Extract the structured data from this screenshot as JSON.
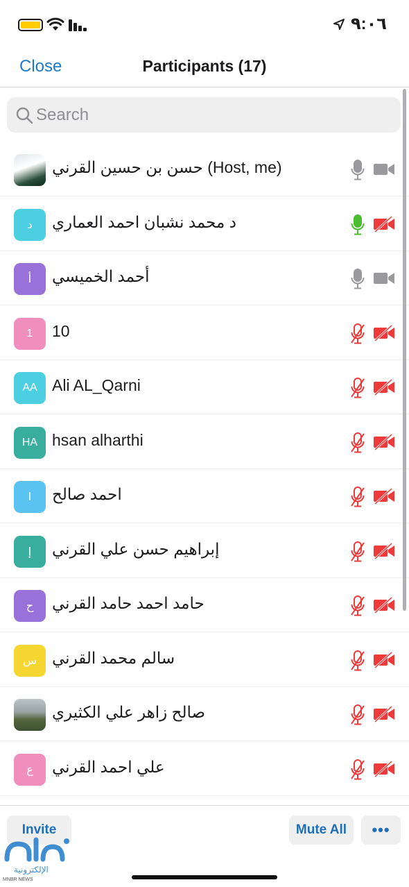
{
  "status_bar": {
    "time": "٩:٠٦",
    "icons": [
      "battery-icon",
      "wifi-icon",
      "signal-icon",
      "location-arrow-icon"
    ],
    "battery_color": "#ffcc00"
  },
  "nav": {
    "close_label": "Close",
    "title": "Participants (17)"
  },
  "search": {
    "placeholder": "Search",
    "value": ""
  },
  "participants": [
    {
      "name": "حسن بن حسين القرني (Host, me)",
      "avatar": "photo",
      "initials": "",
      "color": "",
      "mic": "on-idle",
      "camera": "on"
    },
    {
      "name": "د محمد نشبان احمد العماري",
      "avatar": "initials",
      "initials": "د",
      "color": "#4ccfe0",
      "mic": "speaking",
      "camera": "off"
    },
    {
      "name": "أحمد الخميسي",
      "avatar": "initials",
      "initials": "أ",
      "color": "#9872d8",
      "mic": "on-idle",
      "camera": "on"
    },
    {
      "name": "10",
      "avatar": "initials",
      "initials": "1",
      "color": "#f08fbd",
      "mic": "muted",
      "camera": "off"
    },
    {
      "name": "Ali AL_Qarni",
      "avatar": "initials",
      "initials": "AA",
      "color": "#4ccfe0",
      "mic": "muted",
      "camera": "off"
    },
    {
      "name": "hsan alharthi",
      "avatar": "initials",
      "initials": "HA",
      "color": "#3aae9e",
      "mic": "muted",
      "camera": "off"
    },
    {
      "name": "احمد صالح",
      "avatar": "initials",
      "initials": "ا",
      "color": "#5ac3f2",
      "mic": "muted",
      "camera": "off"
    },
    {
      "name": "إبراهيم حسن علي القرني",
      "avatar": "initials",
      "initials": "إ",
      "color": "#3aae9e",
      "mic": "muted",
      "camera": "off"
    },
    {
      "name": "حامد احمد حامد القرني",
      "avatar": "initials",
      "initials": "ح",
      "color": "#9872d8",
      "mic": "muted",
      "camera": "off"
    },
    {
      "name": "سالم محمد القرني",
      "avatar": "initials",
      "initials": "س",
      "color": "#f6d630",
      "mic": "muted",
      "camera": "off"
    },
    {
      "name": "صالح زاهر علي الكثيري",
      "avatar": "photo",
      "initials": "",
      "color": "",
      "mic": "muted",
      "camera": "off"
    },
    {
      "name": "علي احمد القرني",
      "avatar": "initials",
      "initials": "ع",
      "color": "#f08fbd",
      "mic": "muted",
      "camera": "off"
    }
  ],
  "colors": {
    "accent": "#1e7ac9",
    "muted_red": "#ee3a3a",
    "speaking_green": "#4cbc30",
    "idle_gray": "#9a9a9e"
  },
  "toolbar": {
    "invite_label": "Invite",
    "mute_all_label": "Mute All",
    "more_label": "•••"
  },
  "watermark": {
    "text": "الإلكترونية",
    "small": "MNBR NEWS"
  }
}
